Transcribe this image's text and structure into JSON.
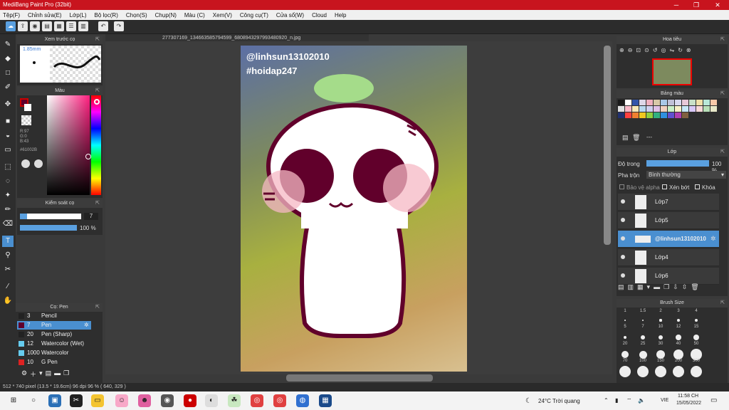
{
  "app": {
    "title": "MediBang Paint Pro (32bit)"
  },
  "menu": [
    "Tệp(F)",
    "Chỉnh sửa(E)",
    "Lớp(L)",
    "Bộ lọc(R)",
    "Chọn(S)",
    "Chụp(N)",
    "Màu (C)",
    "Xem(V)",
    "Công cụ(T)",
    "Cửa sổ(W)",
    "Cloud",
    "Help"
  ],
  "document": {
    "tab": "277307169_134663585794599_6808943297993480920_n.jpg"
  },
  "canvas": {
    "text1": "@linhsun13102010",
    "text2": "#hoidap247"
  },
  "preview": {
    "title": "Xem trước cọ",
    "size": "1.85mm"
  },
  "color": {
    "title": "Màu",
    "r": "R:97",
    "g": "G:0",
    "b": "B:43",
    "hex": "#61002B",
    "accent": "#61002B"
  },
  "brush_control": {
    "title": "Kiểm soát cọ",
    "size": "7",
    "opacity": "100 %"
  },
  "brushes": {
    "title": "Cọ: Pen",
    "items": [
      {
        "size": "3",
        "name": "Pencil",
        "color": "#222222"
      },
      {
        "size": "7",
        "name": "Pen",
        "color": "#61002B"
      },
      {
        "size": "20",
        "name": "Pen (Sharp)",
        "color": "#222222"
      },
      {
        "size": "12",
        "name": "Watercolor (Wet)",
        "color": "#66ccee"
      },
      {
        "size": "1000",
        "name": "Watercolor",
        "color": "#66ccee"
      },
      {
        "size": "10",
        "name": "G Pen",
        "color": "#dd2222"
      }
    ]
  },
  "navigator": {
    "title": "Hoa tiêu"
  },
  "palette": {
    "title": "Bảng màu",
    "empty": "---"
  },
  "layers": {
    "title": "Lớp",
    "opacity_label": "Độ trong",
    "opacity": "100 %",
    "blend_label": "Pha trộn",
    "blend": "Bình thường",
    "protect_alpha": "Bảo vệ alpha",
    "clipping": "Xén bớt",
    "lock": "Khóa",
    "items": [
      "Lớp7",
      "Lớp5",
      "@linhsun13102010",
      "Lớp4",
      "Lớp6"
    ]
  },
  "brush_size": {
    "title": "Brush Size",
    "labels": [
      "1",
      "1.5",
      "2",
      "3",
      "4",
      "5",
      "7",
      "10",
      "12",
      "15",
      "20",
      "25",
      "30",
      "40",
      "50",
      "70",
      "100",
      "150",
      "200",
      "300"
    ]
  },
  "status": {
    "text": "512 * 740 pixel  (13.5 * 19.6cm)  96 dpi  96 %  ( 640, 329 )"
  },
  "taskbar": {
    "weather": "24°C  Trời quang",
    "lang": "VIE",
    "time": "11:58 CH",
    "date": "15/05/2022"
  }
}
